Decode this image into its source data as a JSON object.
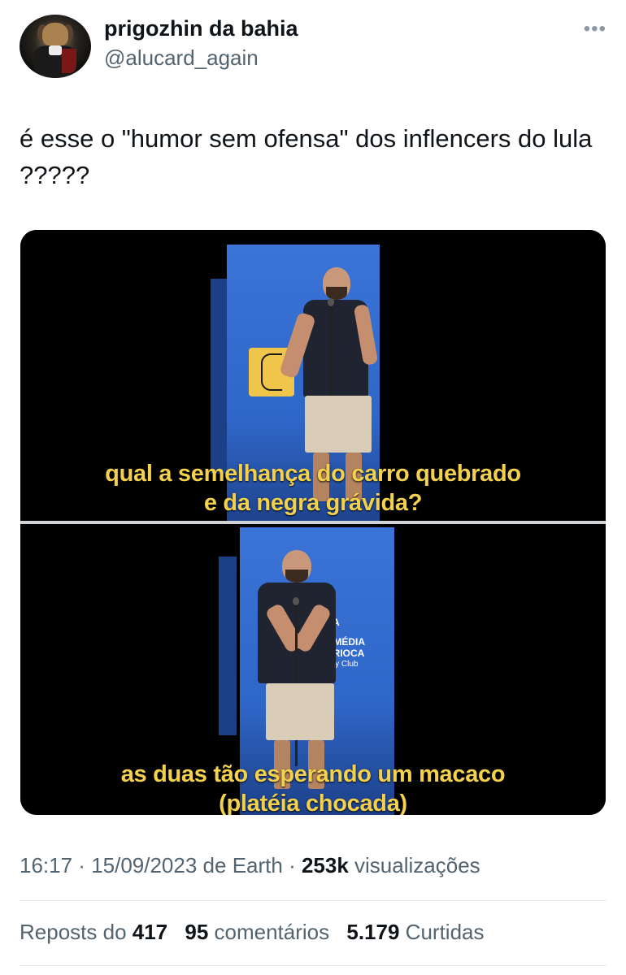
{
  "author": {
    "name": "prigozhin da bahia",
    "handle": "@alucard_again",
    "avatar_icon": "avatar-dog-in-costume"
  },
  "more_icon": "ellipsis-icon",
  "more_glyph": "•••",
  "tweet": {
    "text": "é esse o \"humor sem ofensa\" dos inflencers do lula ?????"
  },
  "media": {
    "panels": [
      {
        "caption_line1": "qual a semelhança do carro quebrado",
        "caption_line2": "e da negra grávida?"
      },
      {
        "caption_line1": "as duas tão esperando um macaco",
        "caption_line2": "(platéia chocada)",
        "stage_sign": {
          "line1": "SA",
          "line2": "OMÉDIA",
          "line3": "ARIOCA",
          "line4": "edy Club"
        }
      }
    ]
  },
  "meta": {
    "time": "16:17",
    "dot1": " · ",
    "date": "15/09/2023",
    "source": " de Earth",
    "dot2": " · ",
    "views_count": "253k",
    "views_label": " visualizações"
  },
  "stats": {
    "reposts_label": "Reposts do ",
    "reposts_count": "417",
    "comments_count": "95",
    "comments_label": " comentários",
    "likes_count": "5.179",
    "likes_label": " Curtidas"
  },
  "colors": {
    "caption": "#f3d14c",
    "secondary_text": "#536471",
    "primary_text": "#0f1419",
    "stage_blue": "#3a74d6"
  }
}
